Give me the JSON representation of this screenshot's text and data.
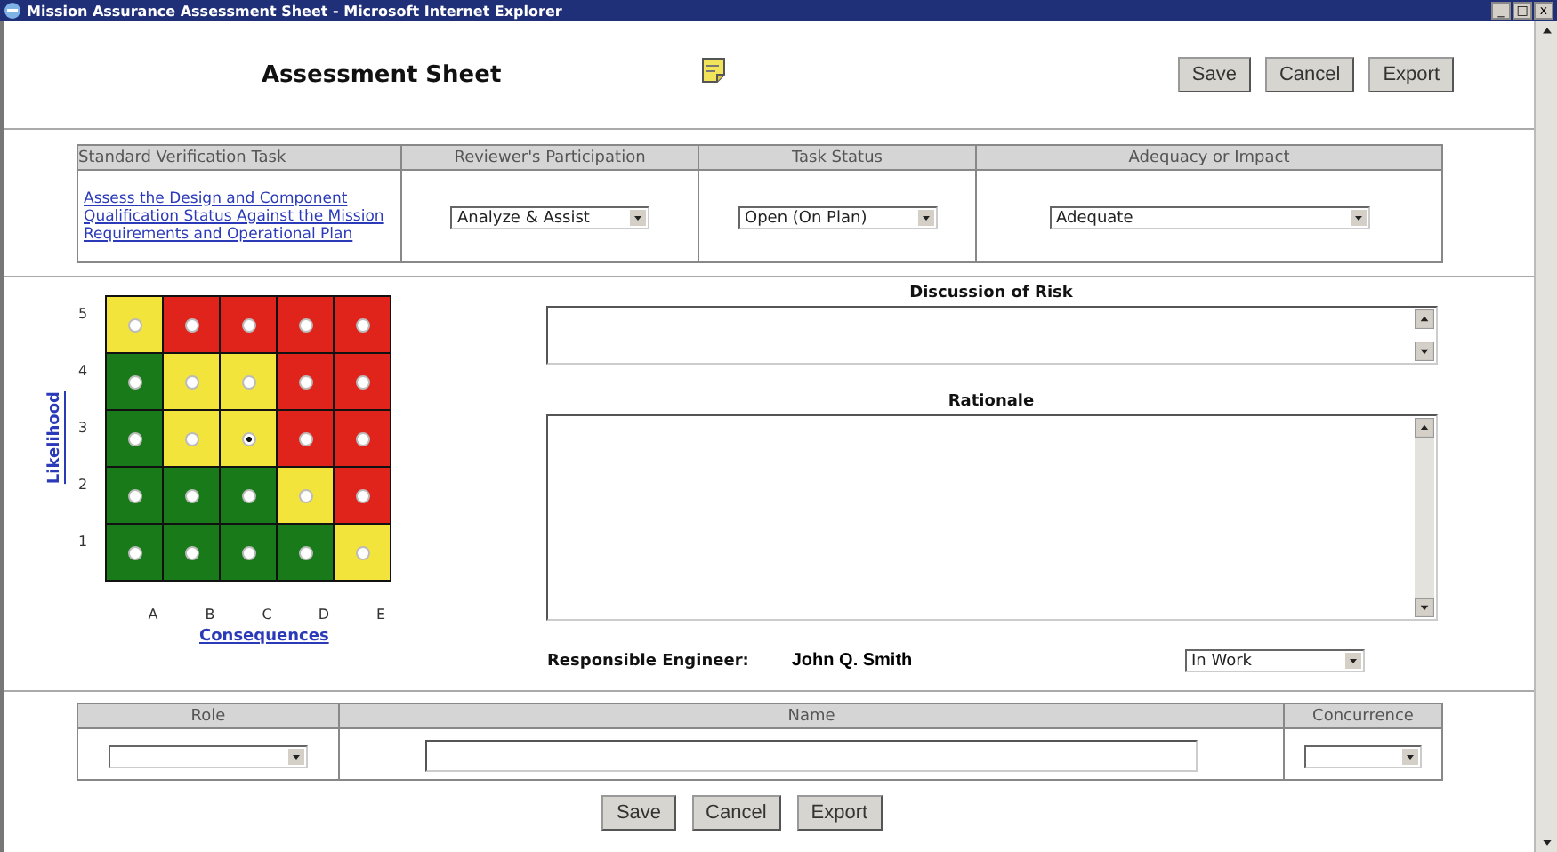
{
  "window": {
    "title": "Mission Assurance Assessment Sheet - Microsoft Internet Explorer",
    "controls": [
      "_",
      "□",
      "x"
    ]
  },
  "header": {
    "title": "Assessment Sheet",
    "buttons": [
      "Save",
      "Cancel",
      "Export"
    ]
  },
  "task_table": {
    "columns": [
      "Standard Verification Task",
      "Reviewer's Participation",
      "Task Status",
      "Adequacy or Impact"
    ],
    "task_link": "Assess the Design and Component Qualification Status Against the Mission Requirements and Operational Plan",
    "participation": "Analyze & Assist",
    "status": "Open (On Plan)",
    "adequacy": "Adequate"
  },
  "risk_matrix": {
    "row_labels": [
      "5",
      "4",
      "3",
      "2",
      "1"
    ],
    "column_labels": [
      "A",
      "B",
      "C",
      "D",
      "E"
    ],
    "y_axis": "Likelihood",
    "x_axis": "Consequences",
    "rows": [
      [
        {
          "color": "#f2e43a",
          "selected": false
        },
        {
          "color": "#e0241c",
          "selected": false
        },
        {
          "color": "#e0241c",
          "selected": false
        },
        {
          "color": "#e0241c",
          "selected": false
        },
        {
          "color": "#e0241c",
          "selected": false
        }
      ],
      [
        {
          "color": "#197a1a",
          "selected": false
        },
        {
          "color": "#f2e43a",
          "selected": false
        },
        {
          "color": "#f2e43a",
          "selected": false
        },
        {
          "color": "#e0241c",
          "selected": false
        },
        {
          "color": "#e0241c",
          "selected": false
        }
      ],
      [
        {
          "color": "#197a1a",
          "selected": false
        },
        {
          "color": "#f2e43a",
          "selected": false
        },
        {
          "color": "#f2e43a",
          "selected": true
        },
        {
          "color": "#e0241c",
          "selected": false
        },
        {
          "color": "#e0241c",
          "selected": false
        }
      ],
      [
        {
          "color": "#197a1a",
          "selected": false
        },
        {
          "color": "#197a1a",
          "selected": false
        },
        {
          "color": "#197a1a",
          "selected": false
        },
        {
          "color": "#f2e43a",
          "selected": false
        },
        {
          "color": "#e0241c",
          "selected": false
        }
      ],
      [
        {
          "color": "#197a1a",
          "selected": false
        },
        {
          "color": "#197a1a",
          "selected": false
        },
        {
          "color": "#197a1a",
          "selected": false
        },
        {
          "color": "#197a1a",
          "selected": false
        },
        {
          "color": "#f2e43a",
          "selected": false
        }
      ]
    ]
  },
  "discussion_label": "Discussion of Risk",
  "rationale_label": "Rationale",
  "engineer": {
    "label": "Responsible Engineer:",
    "name": "John Q. Smith",
    "state": "In Work"
  },
  "concurrence_table": {
    "columns": [
      "Role",
      "Name",
      "Concurrence"
    ]
  },
  "footer_buttons": [
    "Save",
    "Cancel",
    "Export"
  ]
}
